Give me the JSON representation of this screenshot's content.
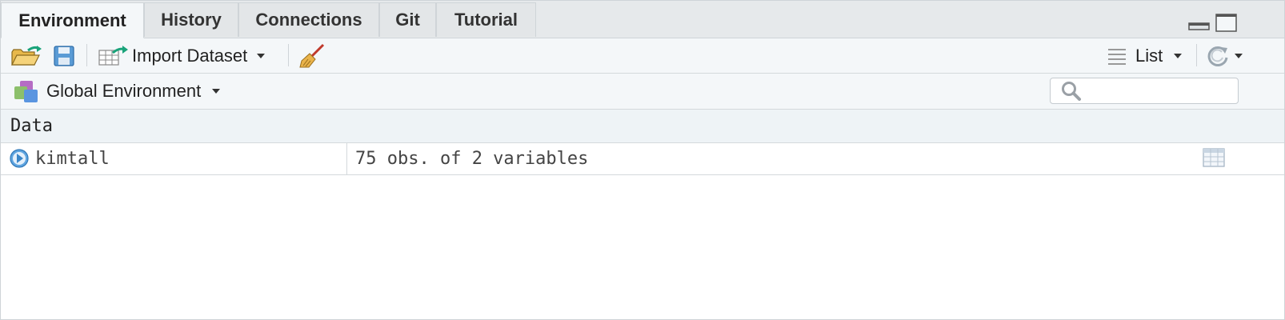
{
  "tabs": [
    {
      "label": "Environment",
      "active": true
    },
    {
      "label": "History",
      "active": false
    },
    {
      "label": "Connections",
      "active": false
    },
    {
      "label": "Git",
      "active": false
    },
    {
      "label": "Tutorial",
      "active": false
    }
  ],
  "toolbar": {
    "open_icon": "folder-open-icon",
    "save_icon": "save-icon",
    "import_label": "Import Dataset",
    "broom_icon": "broom-icon",
    "view_label": "List",
    "refresh_icon": "refresh-icon"
  },
  "env": {
    "selector_label": "Global Environment",
    "search_placeholder": ""
  },
  "section": {
    "title": "Data"
  },
  "rows": [
    {
      "name": "kimtall",
      "value": "75 obs. of 2 variables"
    }
  ],
  "colors": {
    "accent": "#4a90d9",
    "border": "#cfd4d8",
    "toolbar_bg": "#f4f7f9"
  }
}
